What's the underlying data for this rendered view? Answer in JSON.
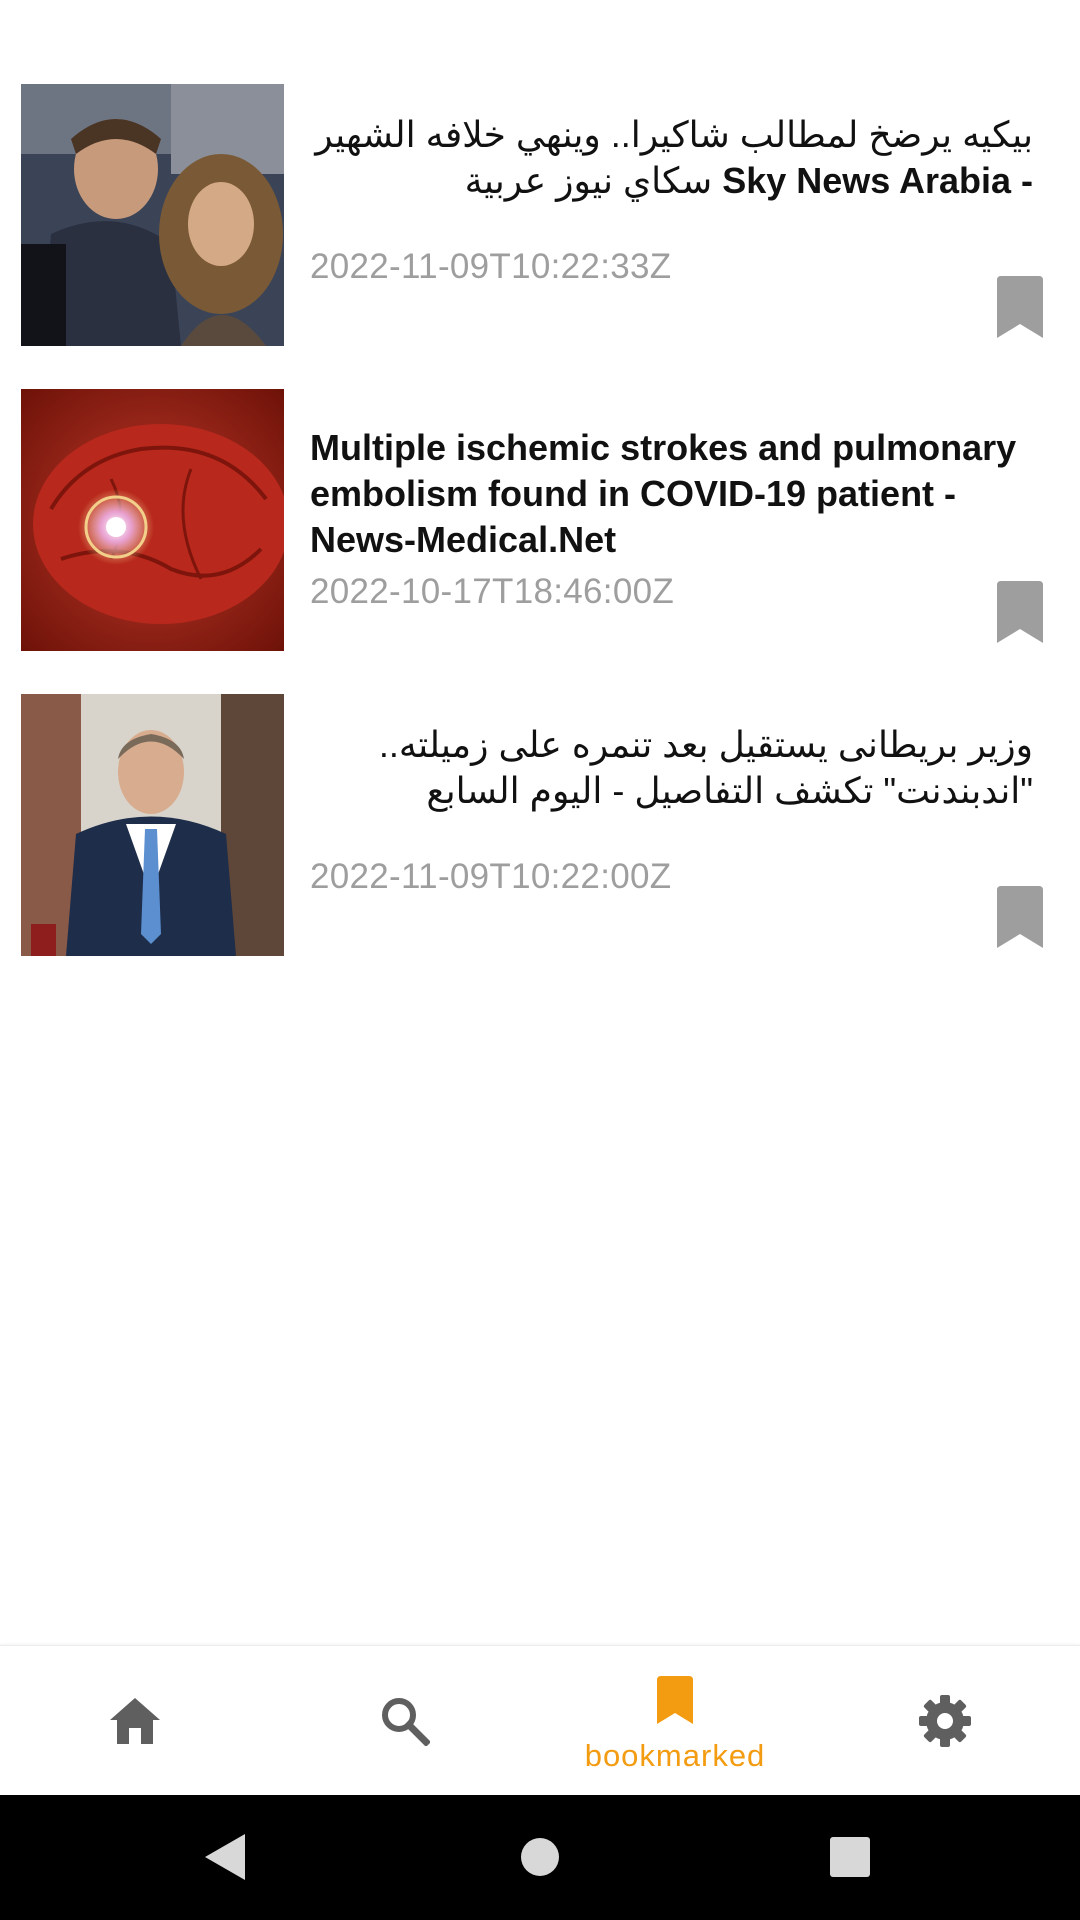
{
  "articles": [
    {
      "title_main": "بيكيه يرضخ لمطالب شاكيرا.. وينهي خلافه الشهير",
      "title_source": "- Sky News Arabia",
      "title_rest": "سكاي نيوز عربية",
      "date": "2022-11-09T10:22:33Z",
      "direction": "rtl"
    },
    {
      "title": "Multiple ischemic strokes and pulmonary embolism found in COVID-19 patient - News-Medical.Net",
      "date": "2022-10-17T18:46:00Z",
      "direction": "ltr"
    },
    {
      "title": "وزير بريطانى يستقيل بعد تنمره على زميلته.. \"اندبندنت\" تكشف التفاصيل - اليوم السابع",
      "date": "2022-11-09T10:22:00Z",
      "direction": "rtl"
    }
  ],
  "bottom_nav": {
    "items": [
      {
        "icon": "home-icon",
        "label": ""
      },
      {
        "icon": "search-icon",
        "label": ""
      },
      {
        "icon": "bookmark-icon",
        "label": "bookmarked",
        "active": true
      },
      {
        "icon": "gear-icon",
        "label": ""
      }
    ]
  },
  "colors": {
    "accent": "#f39c12",
    "icon_gray": "#5f5f5f",
    "bookmark_gray": "#9e9e9e",
    "date_gray": "#9e9e9e"
  }
}
